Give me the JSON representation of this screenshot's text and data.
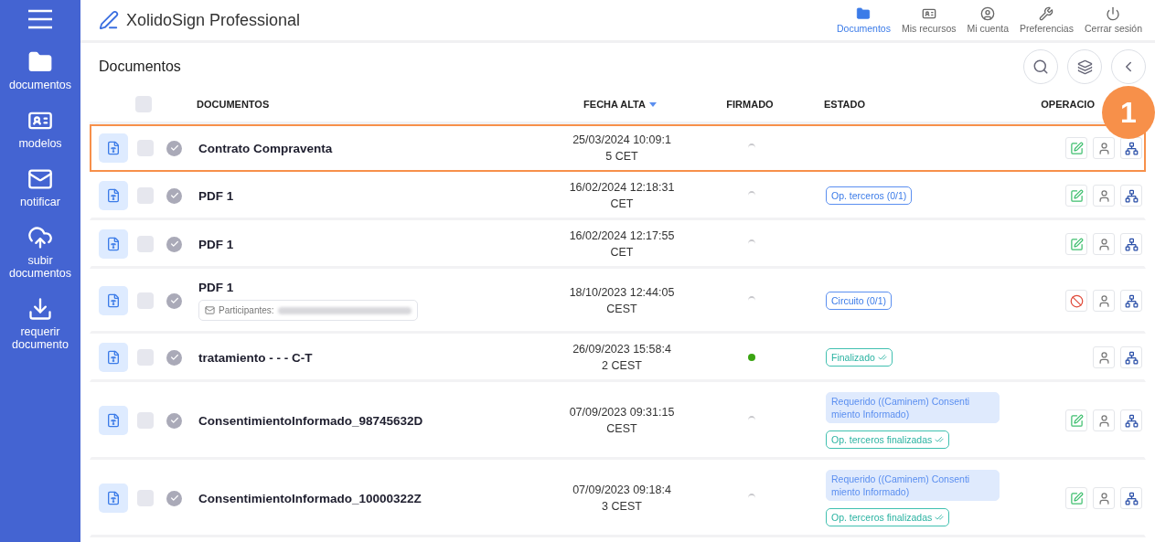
{
  "app": {
    "title": "XolidoSign Professional"
  },
  "sidebar": {
    "items": [
      {
        "label": "documentos"
      },
      {
        "label": "modelos"
      },
      {
        "label": "notificar"
      },
      {
        "label": "subir documentos"
      },
      {
        "label": "requerir documento"
      }
    ]
  },
  "topnav": [
    {
      "label": "Documentos",
      "selected": true
    },
    {
      "label": "Mis recursos",
      "selected": false
    },
    {
      "label": "Mi cuenta",
      "selected": false
    },
    {
      "label": "Preferencias",
      "selected": false
    },
    {
      "label": "Cerrar sesión",
      "selected": false
    }
  ],
  "page": {
    "title": "Documentos"
  },
  "table": {
    "columns": [
      "DOCUMENTOS",
      "FECHA ALTA",
      "FIRMADO",
      "ESTADO",
      "OPERACIO"
    ],
    "select_all": {
      "checked": false
    },
    "rows": [
      {
        "name": "Contrato Compraventa",
        "checked": false,
        "date": [
          "25/03/2024 10:09:1",
          "5 CET"
        ],
        "signed": false,
        "highlighted": true,
        "tags": [],
        "ops": [
          {
            "kind": "edit"
          },
          {
            "kind": "user"
          },
          {
            "kind": "tree"
          }
        ]
      },
      {
        "name": "PDF 1",
        "checked": false,
        "date": [
          "16/02/2024 12:18:31",
          "CET"
        ],
        "signed": false,
        "highlighted": false,
        "tags": [
          {
            "kind": "outline",
            "lines": [
              "Op. terceros (0/1)"
            ]
          }
        ],
        "ops": [
          {
            "kind": "edit"
          },
          {
            "kind": "user"
          },
          {
            "kind": "tree"
          }
        ]
      },
      {
        "name": "PDF 1",
        "checked": false,
        "date": [
          "16/02/2024 12:17:55",
          "CET"
        ],
        "signed": false,
        "highlighted": false,
        "tags": [],
        "ops": [
          {
            "kind": "edit"
          },
          {
            "kind": "user"
          },
          {
            "kind": "tree"
          }
        ]
      },
      {
        "name": "PDF 1",
        "checked": false,
        "participants": "Participantes:",
        "date": [
          "18/10/2023 12:44:05",
          "CEST"
        ],
        "signed": false,
        "highlighted": false,
        "tags": [
          {
            "kind": "outline",
            "lines": [
              "Circuito (0/1)"
            ]
          }
        ],
        "ops": [
          {
            "kind": "block"
          },
          {
            "kind": "user"
          },
          {
            "kind": "tree"
          }
        ]
      },
      {
        "name": "tratamiento - - - C-T",
        "checked": false,
        "date": [
          "26/09/2023 15:58:4",
          "2 CEST"
        ],
        "signed": true,
        "highlighted": false,
        "tags": [
          {
            "kind": "done",
            "lines": [
              "Finalizado"
            ]
          }
        ],
        "ops": [
          {
            "kind": "user"
          },
          {
            "kind": "tree"
          }
        ]
      },
      {
        "name": "ConsentimientoInformado_98745632D",
        "checked": false,
        "date": [
          "07/09/2023 09:31:15",
          "CEST"
        ],
        "signed": false,
        "highlighted": false,
        "tags": [
          {
            "kind": "filled",
            "lines": [
              "Requerido ((Caminem) Consenti",
              "miento Informado)"
            ]
          },
          {
            "kind": "done",
            "lines": [
              "Op. terceros finalizadas"
            ]
          }
        ],
        "ops": [
          {
            "kind": "edit"
          },
          {
            "kind": "user"
          },
          {
            "kind": "tree"
          }
        ]
      },
      {
        "name": "ConsentimientoInformado_10000322Z",
        "checked": false,
        "date": [
          "07/09/2023 09:18:4",
          "3 CEST"
        ],
        "signed": false,
        "highlighted": false,
        "tags": [
          {
            "kind": "filled",
            "lines": [
              "Requerido ((Caminem) Consenti",
              "miento Informado)"
            ]
          },
          {
            "kind": "done",
            "lines": [
              "Op. terceros finalizadas"
            ]
          }
        ],
        "ops": [
          {
            "kind": "edit"
          },
          {
            "kind": "user"
          },
          {
            "kind": "tree"
          }
        ]
      }
    ]
  },
  "callout": {
    "number": "1"
  }
}
